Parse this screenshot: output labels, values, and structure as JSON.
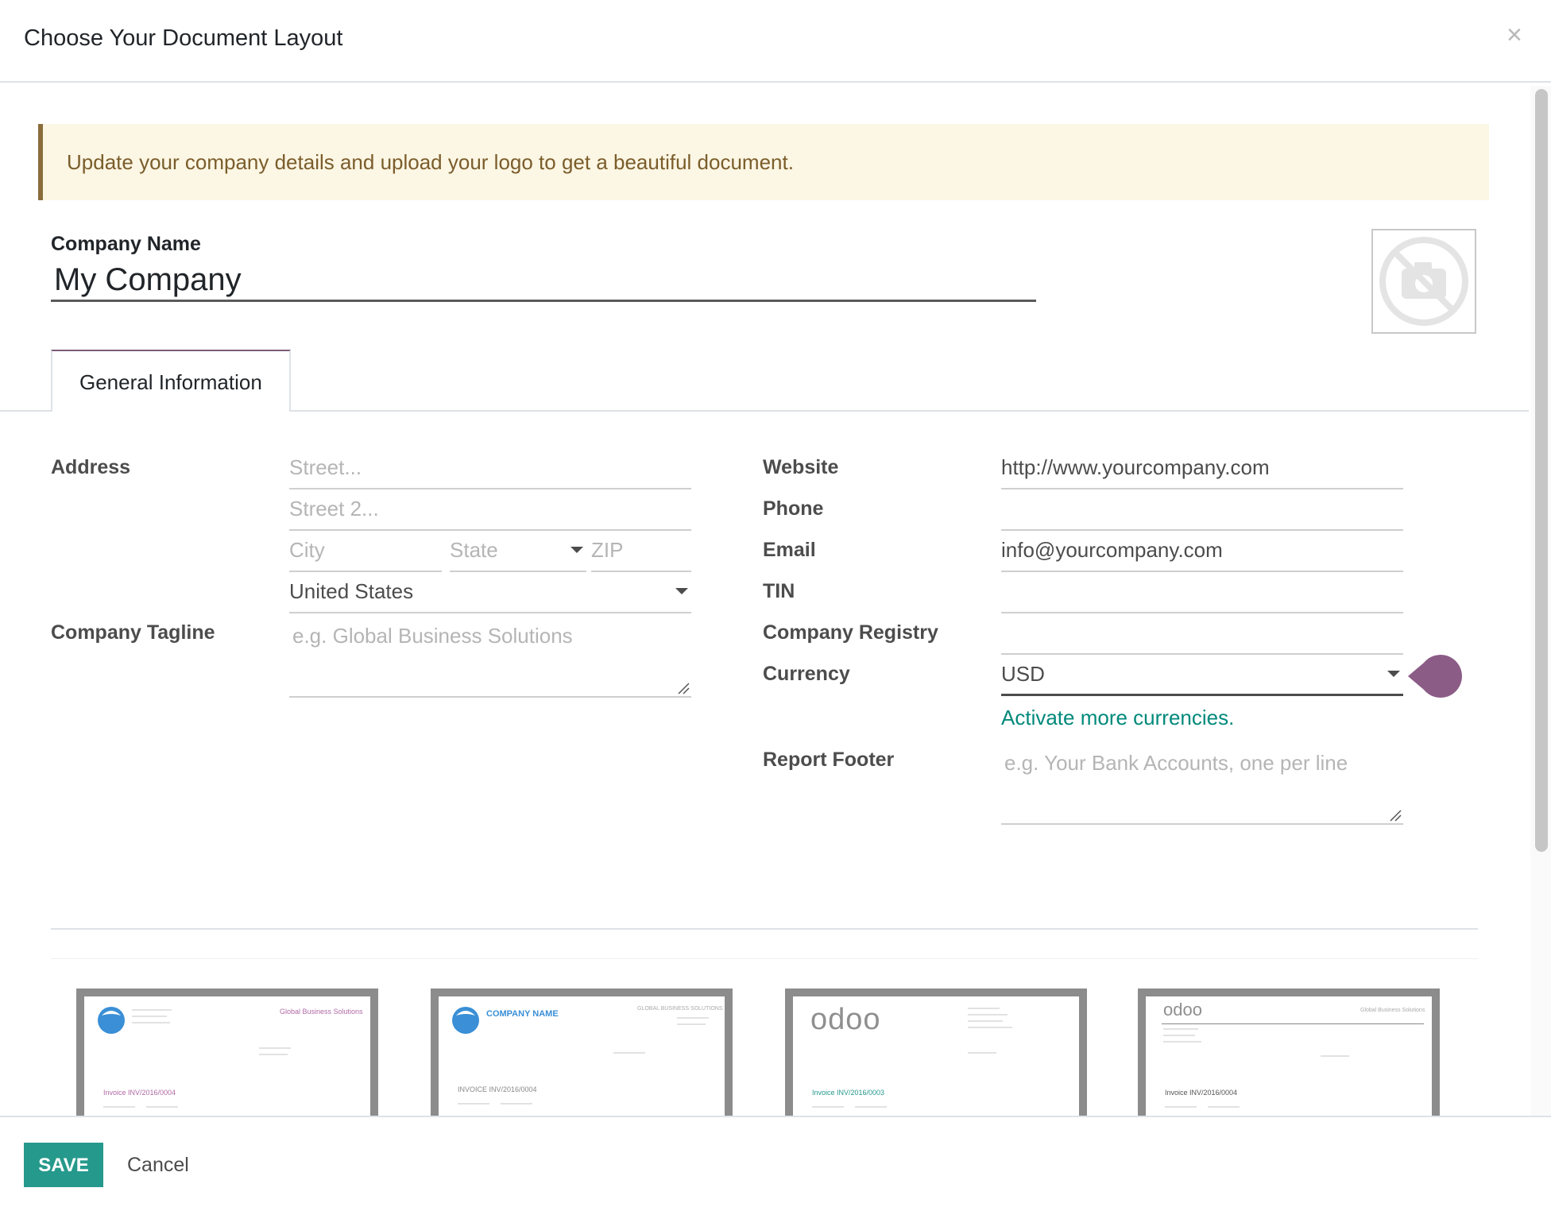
{
  "dialog": {
    "title": "Choose Your Document Layout",
    "close_icon": "×"
  },
  "alert": {
    "text": "Update your company details and upload your logo to get a beautiful document."
  },
  "company": {
    "name_label": "Company Name",
    "name_value": "My Company",
    "logo_icon": "camera-off-icon"
  },
  "tabs": [
    {
      "label": "General Information",
      "active": true
    }
  ],
  "left_form": {
    "address_label": "Address",
    "street_placeholder": "Street...",
    "street2_placeholder": "Street 2...",
    "city_placeholder": "City",
    "state_placeholder": "State",
    "zip_placeholder": "ZIP",
    "country_value": "United States",
    "tagline_label": "Company Tagline",
    "tagline_placeholder": "e.g. Global Business Solutions"
  },
  "right_form": {
    "website_label": "Website",
    "website_value": "http://www.yourcompany.com",
    "phone_label": "Phone",
    "phone_value": "",
    "email_label": "Email",
    "email_value": "info@yourcompany.com",
    "tin_label": "TIN",
    "tin_value": "",
    "registry_label": "Company Registry",
    "registry_value": "",
    "currency_label": "Currency",
    "currency_value": "USD",
    "activate_link": "Activate more currencies.",
    "footer_label": "Report Footer",
    "footer_placeholder": "e.g. Your Bank Accounts, one per line"
  },
  "layouts": [
    {
      "company": "",
      "tagline": "Global Business Solutions",
      "invoice": "Invoice INV/2016/0004"
    },
    {
      "company": "COMPANY NAME",
      "tagline": "GLOBAL BUSINESS SOLUTIONS",
      "invoice": "INVOICE INV/2016/0004"
    },
    {
      "company": "odoo",
      "tagline": "",
      "invoice": "Invoice INV/2016/0003"
    },
    {
      "company": "odoo",
      "tagline": "Global Business Solutions",
      "invoice": "Invoice INV/2016/0004"
    }
  ],
  "footer": {
    "save_label": "SAVE",
    "cancel_label": "Cancel"
  },
  "colors": {
    "primary": "#25998c",
    "accent": "#7c5a7a",
    "link": "#00897b",
    "alert_bg": "#fcf6e4"
  }
}
